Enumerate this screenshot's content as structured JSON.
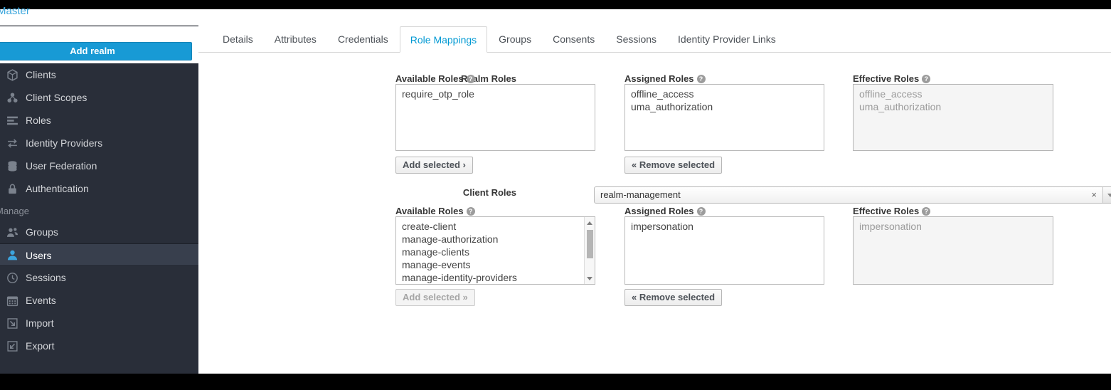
{
  "sidebar": {
    "realm_name": "Master",
    "add_realm_label": "Add realm",
    "configure_items": [
      {
        "label": "Clients",
        "icon": "cube-icon"
      },
      {
        "label": "Client Scopes",
        "icon": "blocks-icon"
      },
      {
        "label": "Roles",
        "icon": "list-icon"
      },
      {
        "label": "Identity Providers",
        "icon": "exchange-arrows-icon"
      },
      {
        "label": "User Federation",
        "icon": "database-icon"
      },
      {
        "label": "Authentication",
        "icon": "lock-icon"
      }
    ],
    "manage_label": "Manage",
    "manage_items": [
      {
        "label": "Groups",
        "icon": "users-group-icon",
        "active": false
      },
      {
        "label": "Users",
        "icon": "user-icon",
        "active": true
      },
      {
        "label": "Sessions",
        "icon": "clock-icon",
        "active": false
      },
      {
        "label": "Events",
        "icon": "calendar-icon",
        "active": false
      },
      {
        "label": "Import",
        "icon": "import-arrow-icon",
        "active": false
      },
      {
        "label": "Export",
        "icon": "export-arrow-icon",
        "active": false
      }
    ],
    "accent_color": "#189ad5",
    "background_color": "#292e39",
    "active_item_color": "#383f4d"
  },
  "tabs": [
    {
      "label": "Details",
      "active": false
    },
    {
      "label": "Attributes",
      "active": false
    },
    {
      "label": "Credentials",
      "active": false
    },
    {
      "label": "Role Mappings",
      "active": true
    },
    {
      "label": "Groups",
      "active": false
    },
    {
      "label": "Consents",
      "active": false
    },
    {
      "label": "Sessions",
      "active": false
    },
    {
      "label": "Identity Provider Links",
      "active": false
    }
  ],
  "realm_roles": {
    "label": "Realm Roles",
    "available": {
      "heading": "Available Roles",
      "help": "?",
      "options": [
        "require_otp_role"
      ],
      "button_label": "Add selected ›",
      "button_disabled": false
    },
    "assigned": {
      "heading": "Assigned Roles",
      "help": "?",
      "options": [
        "offline_access",
        "uma_authorization"
      ],
      "button_label": "« Remove selected",
      "button_disabled": false
    },
    "effective": {
      "heading": "Effective Roles",
      "help": "?",
      "options": [
        "offline_access",
        "uma_authorization"
      ],
      "readonly": true
    }
  },
  "client_roles": {
    "label": "Client Roles",
    "select": {
      "value": "realm-management",
      "clear_icon": "×",
      "arrow_icon": "chevron-down-icon"
    },
    "available": {
      "heading": "Available Roles",
      "help": "?",
      "options": [
        "create-client",
        "manage-authorization",
        "manage-clients",
        "manage-events",
        "manage-identity-providers"
      ],
      "has_scrollbar": true,
      "button_label": "Add selected »",
      "button_disabled": true
    },
    "assigned": {
      "heading": "Assigned Roles",
      "help": "?",
      "options": [
        "impersonation"
      ],
      "button_label": "« Remove selected",
      "button_disabled": false
    },
    "effective": {
      "heading": "Effective Roles",
      "help": "?",
      "options": [
        "impersonation"
      ],
      "readonly": true
    }
  }
}
